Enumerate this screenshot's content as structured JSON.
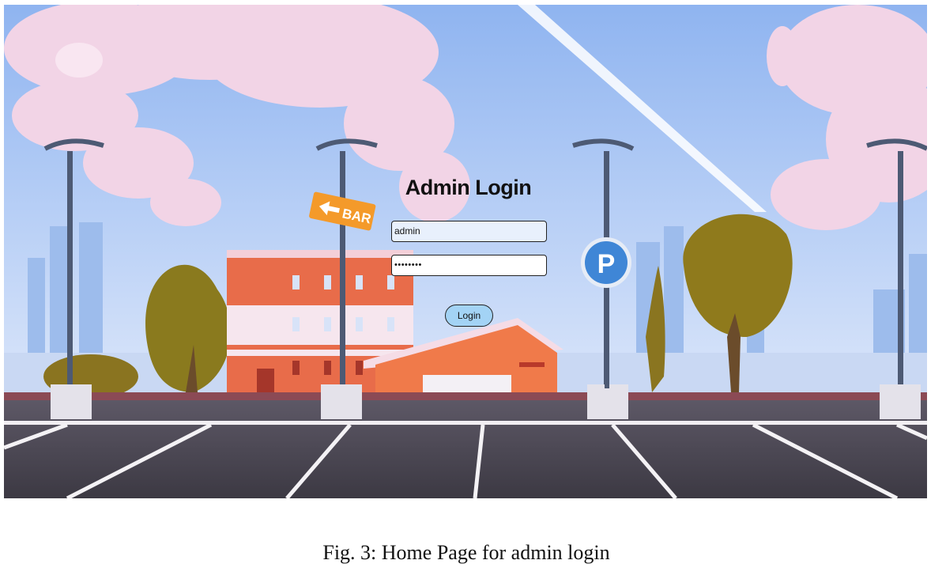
{
  "login": {
    "title": "Admin Login",
    "username_value": "admin",
    "password_value": "••••••••",
    "login_button": "Login"
  },
  "scene": {
    "bar_sign": "BAR",
    "parking_sign": "P"
  },
  "caption": "Fig. 3: Home Page for admin login"
}
